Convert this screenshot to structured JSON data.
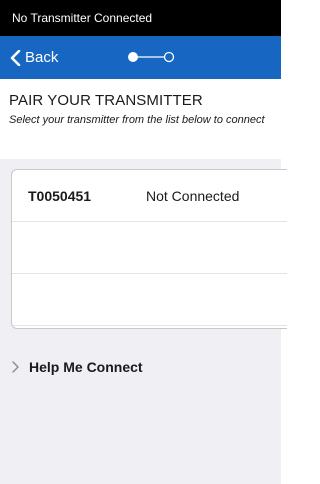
{
  "status_bar": {
    "text": "No Transmitter Connected"
  },
  "nav": {
    "back_label": "Back",
    "step_indicator": {
      "current_step": 1,
      "total_steps": 2
    }
  },
  "header": {
    "title": "PAIR YOUR TRANSMITTER",
    "subtitle": "Select your transmitter from the list below to connect"
  },
  "transmitters": [
    {
      "id": "T0050451",
      "status": "Not Connected"
    },
    {
      "id": "",
      "status": ""
    },
    {
      "id": "",
      "status": ""
    }
  ],
  "help": {
    "label": "Help Me Connect"
  },
  "colors": {
    "nav_blue": "#1666c2",
    "background": "#efeff4",
    "status_bar": "#000000"
  },
  "icons": {
    "back": "chevron-left-icon",
    "help": "chevron-right-icon",
    "steps": "step-indicator-icon"
  }
}
